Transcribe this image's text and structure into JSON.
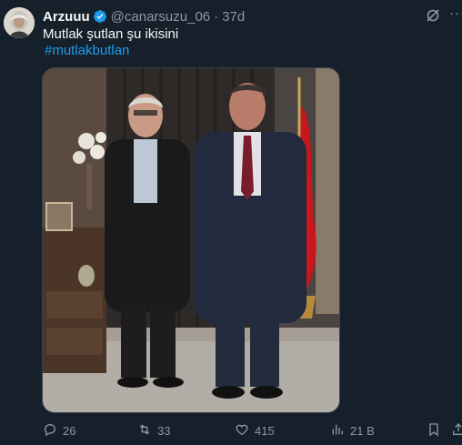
{
  "post": {
    "author_name": "Arzuuu",
    "handle": "@canarsuzu_06",
    "separator": "·",
    "time_ago": "37d",
    "text": "Mutlak şutlan şu ikisini",
    "hashtag": "#mutlakbutlan",
    "more_glyph": "···"
  },
  "actions": {
    "replies": "26",
    "reposts": "33",
    "likes": "415",
    "views": "21 B"
  },
  "icons": [
    "avatar",
    "verified-badge-icon",
    "grok-icon",
    "more-icon",
    "reply-icon",
    "repost-icon",
    "like-icon",
    "views-icon",
    "bookmark-icon",
    "share-icon"
  ],
  "colors": {
    "background": "#15202b",
    "text": "#f7f9f9",
    "muted": "#8b98a5",
    "accent": "#1d9bf0"
  }
}
